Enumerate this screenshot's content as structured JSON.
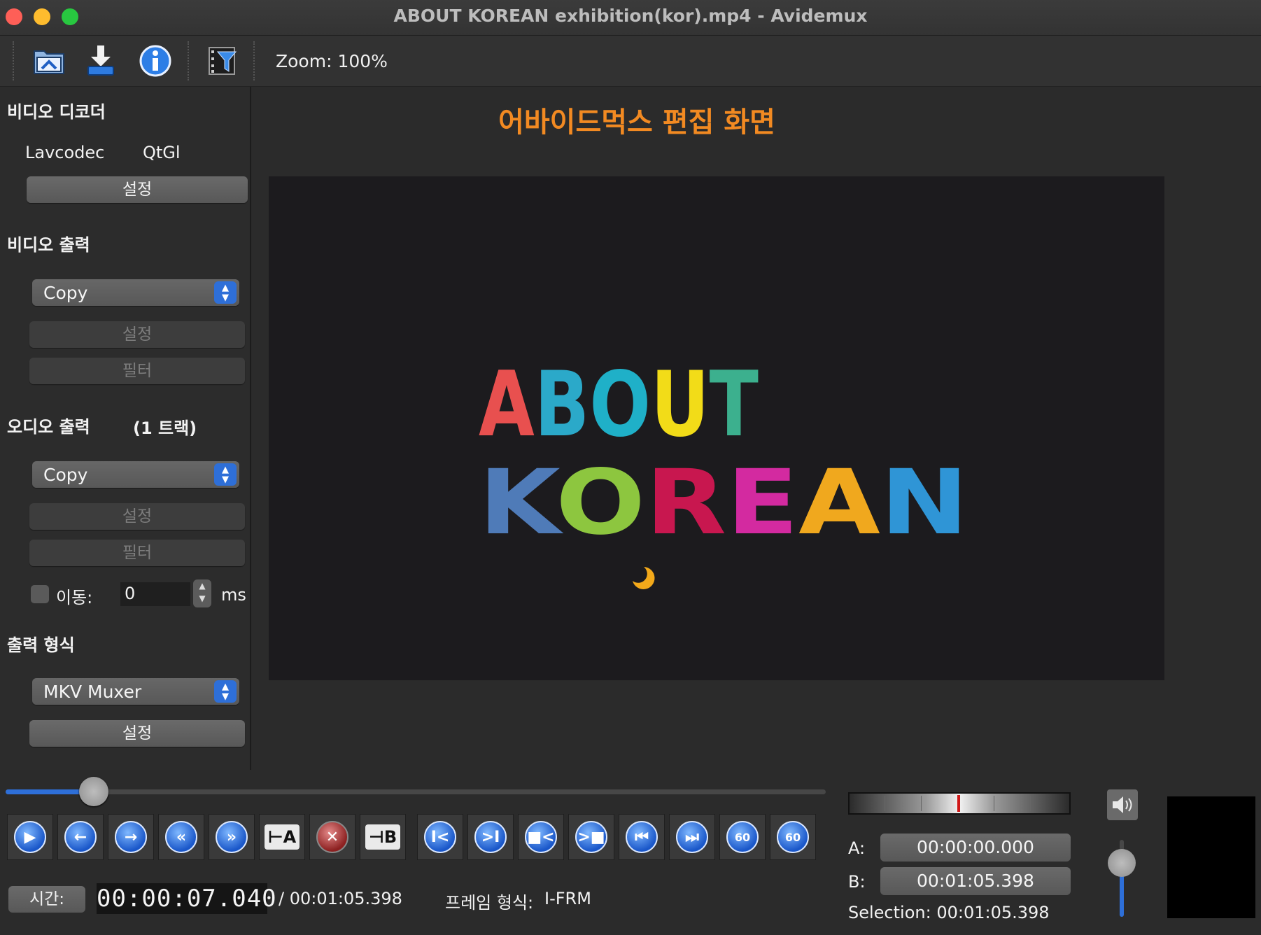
{
  "window": {
    "title": "ABOUT KOREAN exhibition(kor).mp4 - Avidemux"
  },
  "toolbar": {
    "zoom_label": "Zoom: 100%",
    "icons": [
      "open-folder-icon",
      "save-download-icon",
      "info-icon",
      "filter-icon"
    ]
  },
  "sidebar": {
    "video_decoder": {
      "heading": "비디오 디코더",
      "decoder": "Lavcodec",
      "renderer": "QtGl",
      "settings": "설정"
    },
    "video_output": {
      "heading": "비디오 출력",
      "codec": "Copy",
      "settings": "설정",
      "filters": "필터"
    },
    "audio_output": {
      "heading": "오디오 출력",
      "tracks": "(1 트랙)",
      "codec": "Copy",
      "settings": "설정",
      "filters": "필터",
      "shift_label": "이동:",
      "shift_value": "0",
      "shift_unit": "ms"
    },
    "output_format": {
      "heading": "출력 형식",
      "muxer": "MKV Muxer",
      "settings": "설정"
    }
  },
  "preview": {
    "caption": "어바이드먹스 편집 화면",
    "frame": {
      "line1": "ABOUT",
      "line2": "KOREAN",
      "colors": {
        "A": "#e8504f",
        "B": "#2ba9c9",
        "O": "#1fb0c8",
        "U": "#f2dc18",
        "T": "#3cb08e",
        "K": "#4f7bb8",
        "O2": "#8dc63f",
        "R": "#c8174f",
        "E": "#d32aa0",
        "A2": "#f0a81e",
        "N": "#2f95d6"
      }
    }
  },
  "playback": {
    "position": 0.1072,
    "buttons": [
      "play",
      "previous-frame",
      "next-frame",
      "rewind",
      "fast-forward",
      "set-marker-a",
      "delete-selection",
      "set-marker-b",
      "goto-marker-a",
      "goto-marker-b",
      "previous-black-frame",
      "next-black-frame",
      "goto-start",
      "goto-end",
      "back-60",
      "forward-60"
    ],
    "labels": {
      "marker_a": "A",
      "marker_b": "B",
      "sixty": "60"
    }
  },
  "status": {
    "time_button": "시간:",
    "current_time": "00:00:07.040",
    "total_time": "/ 00:01:05.398",
    "frame_type_label": "프레임 형식:",
    "frame_type": "I-FRM"
  },
  "selection": {
    "a_label": "A:",
    "a_time": "00:00:00.000",
    "b_label": "B:",
    "b_time": "00:01:05.398",
    "selection_text": "Selection: 00:01:05.398"
  },
  "volume": {
    "level": 0.7
  }
}
